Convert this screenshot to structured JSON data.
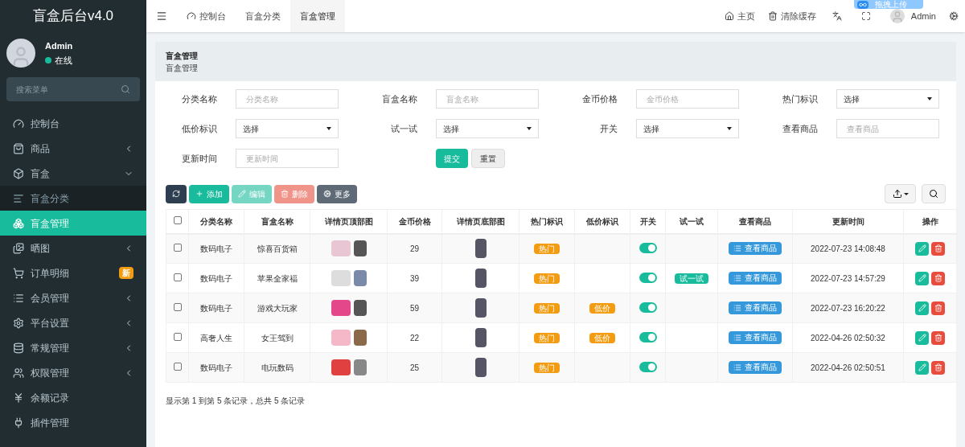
{
  "sidebar": {
    "logo": "盲盒后台v4.0",
    "user": {
      "name": "Admin",
      "status": "在线"
    },
    "search": {
      "placeholder": "搜索菜单"
    },
    "items": [
      {
        "label": "控制台",
        "selected": false
      },
      {
        "label": "商品",
        "selected": false,
        "expanded": false
      },
      {
        "label": "盲盒",
        "selected": false,
        "expanded": true,
        "children": [
          {
            "label": "盲盒分类",
            "selected": false
          },
          {
            "label": "盲盒管理",
            "selected": true
          }
        ]
      },
      {
        "label": "晒图",
        "selected": false,
        "expanded": false
      },
      {
        "label": "订单明细",
        "selected": false,
        "badge": "新"
      },
      {
        "label": "会员管理",
        "selected": false,
        "expanded": false
      },
      {
        "label": "平台设置",
        "selected": false,
        "expanded": false
      },
      {
        "label": "常规管理",
        "selected": false,
        "expanded": false
      },
      {
        "label": "权限管理",
        "selected": false,
        "expanded": false
      },
      {
        "label": "余额记录",
        "selected": false
      },
      {
        "label": "插件管理",
        "selected": false
      }
    ]
  },
  "topbar": {
    "tabs": [
      {
        "label": "控制台",
        "selected": false
      },
      {
        "label": "盲盒分类",
        "selected": false
      },
      {
        "label": "盲盒管理",
        "selected": true
      }
    ],
    "links": [
      "主页",
      "清除缓存"
    ],
    "user": "Admin",
    "upload_widget": "拖拽上传"
  },
  "panel": {
    "title": "盲盒管理",
    "subtitle": "盲盒管理",
    "filters": [
      {
        "label": "分类名称",
        "kind": "text",
        "placeholder": "分类名称"
      },
      {
        "label": "盲盒名称",
        "kind": "text",
        "placeholder": "盲盒名称"
      },
      {
        "label": "金币价格",
        "kind": "text",
        "placeholder": "金币价格"
      },
      {
        "label": "热门标识",
        "kind": "select",
        "value": "选择"
      },
      {
        "label": "低价标识",
        "kind": "select",
        "value": "选择"
      },
      {
        "label": "试一试",
        "kind": "select",
        "value": "选择"
      },
      {
        "label": "开关",
        "kind": "select",
        "value": "选择"
      },
      {
        "label": "查看商品",
        "kind": "text",
        "placeholder": "查看商品"
      },
      {
        "label": "更新时间",
        "kind": "text",
        "placeholder": "更新时间"
      }
    ],
    "submit": "提交",
    "reset": "重置",
    "toolbar": [
      {
        "kind": "refresh",
        "disabled": false
      },
      {
        "kind": "add",
        "label": "添加",
        "disabled": false
      },
      {
        "kind": "edit",
        "label": "编辑",
        "disabled": true
      },
      {
        "kind": "delete",
        "label": "删除",
        "disabled": true
      },
      {
        "kind": "more",
        "label": "更多",
        "disabled": false
      }
    ],
    "table": {
      "columns": [
        "分类名称",
        "盲盒名称",
        "详情页顶部图",
        "金币价格",
        "详情页底部图",
        "热门标识",
        "低价标识",
        "开关",
        "试一试",
        "查看商品",
        "更新时间",
        "操作"
      ],
      "all_checked": false,
      "rows": [
        {
          "checked": false,
          "category": "数码电子",
          "name": "惊喜百货箱",
          "price": "29",
          "hot": "热门",
          "switch_on": true,
          "view": "查看商品",
          "updated": "2022-07-23 14:08:48"
        },
        {
          "checked": false,
          "category": "数码电子",
          "name": "苹果全家福",
          "price": "39",
          "hot": "热门",
          "switch_on": true,
          "trial": "试一试",
          "view": "查看商品",
          "updated": "2022-07-23 14:57:29"
        },
        {
          "checked": false,
          "category": "数码电子",
          "name": "游戏大玩家",
          "price": "59",
          "hot": "热门",
          "low": "低价",
          "switch_on": true,
          "view": "查看商品",
          "updated": "2022-07-23 16:20:22"
        },
        {
          "checked": false,
          "category": "高奢人生",
          "name": "女王驾到",
          "price": "22",
          "hot": "热门",
          "low": "低价",
          "switch_on": true,
          "view": "查看商品",
          "updated": "2022-04-26 02:50:32"
        },
        {
          "checked": false,
          "category": "数码电子",
          "name": "电玩数码",
          "price": "25",
          "hot": "热门",
          "switch_on": true,
          "view": "查看商品",
          "updated": "2022-04-26 02:50:51"
        }
      ]
    },
    "pagination_info": "显示第 1 到第 5 条记录，总共 5 条记录"
  }
}
